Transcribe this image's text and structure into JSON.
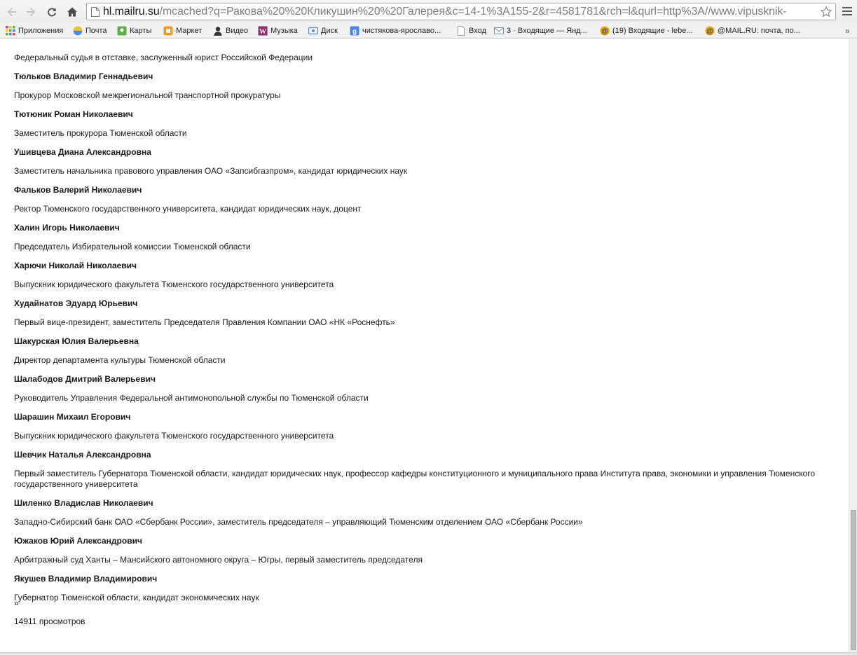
{
  "browser": {
    "url_host": "hl.mailru.su",
    "url_rest": "/mcached?q=Ракова%20%20Кликушин%20%20Галерея&c=14-1%3A155-2&r=4581781&rch=l&qurl=http%3A//www.vipusknik-"
  },
  "bookmarks": [
    {
      "label": "Приложения",
      "icon": "apps-grid-icon",
      "color": "#e8453c"
    },
    {
      "label": "Почта",
      "icon": "mail-yandex-icon",
      "color": "#f7c31b"
    },
    {
      "label": "Карты",
      "icon": "maps-icon",
      "color": "#5fae46"
    },
    {
      "label": "Маркет",
      "icon": "market-icon",
      "color": "#f29a1c"
    },
    {
      "label": "Видео",
      "icon": "video-person-icon",
      "color": "#333333"
    },
    {
      "label": "Музыка",
      "icon": "music-icon",
      "color": "#8e2a6e"
    },
    {
      "label": "Диск",
      "icon": "disk-icon",
      "color": "#5b8fc9"
    },
    {
      "label": "чистякова-ярославо...",
      "icon": "google-search-icon",
      "color": "#4a86e8"
    },
    {
      "label": "Вход",
      "icon": "page-icon",
      "color": "#9a9a9a"
    },
    {
      "label": "3 · Входящие — Янд...",
      "icon": "envelope-icon",
      "color": "#7a8fa8"
    },
    {
      "label": "(19) Входящие - lebe...",
      "icon": "mailru-at-icon",
      "color": "#f0a500"
    },
    {
      "label": "@MAIL.RU: почта, по...",
      "icon": "mailru-at-icon",
      "color": "#f0a500"
    }
  ],
  "bookmarks_more": "»",
  "list": {
    "top_desc": "Федеральный судья в отставке, заслуженный юрист Российской Федерации",
    "entries": [
      {
        "name": "Тюльков Владимир Геннадьевич",
        "desc": "Прокурор Московской межрегиональной транспортной прокуратуры"
      },
      {
        "name": "Тютюник Роман Николаевич",
        "desc": "Заместитель прокурора Тюменской области"
      },
      {
        "name": "Ушивцева Диана Александровна",
        "desc": "Заместитель начальника правового управления ОАО «Запсибгазпром», кандидат юридических наук"
      },
      {
        "name": "Фальков Валерий Николаевич",
        "desc": "Ректор Тюменского государственного университета, кандидат юридических наук, доцент"
      },
      {
        "name": "Халин Игорь Николаевич",
        "desc": "Председатель Избирательной комиссии Тюменской области"
      },
      {
        "name": "Харючи Николай Николаевич",
        "desc": "Выпускник юридического факультета Тюменского государственного университета"
      },
      {
        "name": "Худайнатов Эдуард Юрьевич",
        "desc": "Первый вице-президент, заместитель Председателя Правления Компании ОАО «НК «Роснефть»"
      },
      {
        "name": "Шакурская Юлия Валерьевна",
        "desc": "Директор департамента культуры Тюменской области"
      },
      {
        "name": "Шалабодов Дмитрий Валерьевич",
        "desc": "Руководитель Управления Федеральной антимонопольной службы по Тюменской области"
      },
      {
        "name": "Шарашин Михаил Егорович",
        "desc": "Выпускник юридического факультета Тюменского государственного университета"
      },
      {
        "name": "Шевчик Наталья Александровна",
        "desc": "Первый заместитель Губернатора Тюменской области, кандидат юридических наук, профессор кафедры конституционного и муниципального права Института права, экономики и управления Тюменского государственного университета"
      },
      {
        "name": "Шиленко Владислав Николаевич",
        "desc": "Западно-Сибирский банк ОАО «Сбербанк России», заместитель председателя – управляющий Тюменским отделением ОАО «Сбербанк России»"
      },
      {
        "name": "Южаков Юрий Александрович",
        "desc": "Арбитражный суд Ханты – Мансийского автономного округа – Югры, первый заместитель председателя"
      },
      {
        "name": "Якушев Владимир Владимирович",
        "desc": "Губернатор Тюменской области, кандидат экономических наук"
      }
    ],
    "next_link": "»",
    "views": "14911 просмотров"
  }
}
